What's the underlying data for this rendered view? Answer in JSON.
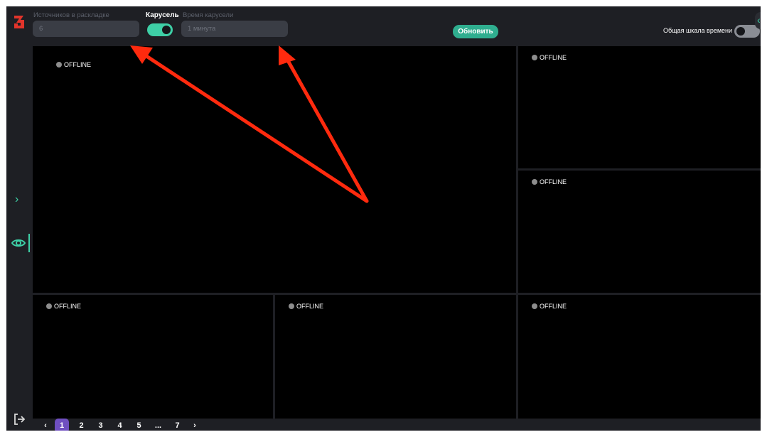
{
  "colors": {
    "accent": "#3ecfa6",
    "logo": "#e2342b",
    "page_active": "#6f4fc0",
    "offline_dot": "#8d8d8d",
    "annotation_arrow": "#ff2a0e"
  },
  "sidebar": {
    "logo_icon": "logo-icon",
    "expand_icon": "chevron-right-icon",
    "expand_glyph": "›",
    "view_icon": "eye-icon",
    "logout_icon": "logout-icon"
  },
  "toolbar": {
    "sources_label": "Источников в раскладке",
    "sources_value": "6",
    "carousel_label": "Карусель",
    "carousel_enabled": true,
    "carousel_time_label": "Время карусели",
    "carousel_time_value": "1 минута",
    "update_button": "Обновить",
    "timeline_label": "Общая шкала времени",
    "timeline_enabled": false
  },
  "tiles": [
    {
      "status": "OFFLINE"
    },
    {
      "status": "OFFLINE"
    },
    {
      "status": "OFFLINE"
    },
    {
      "status": "OFFLINE"
    },
    {
      "status": "OFFLINE"
    },
    {
      "status": "OFFLINE"
    }
  ],
  "pagination": {
    "prev": "‹",
    "pages": [
      "1",
      "2",
      "3",
      "4",
      "5",
      "...",
      "7"
    ],
    "current": "1",
    "next": "›"
  }
}
